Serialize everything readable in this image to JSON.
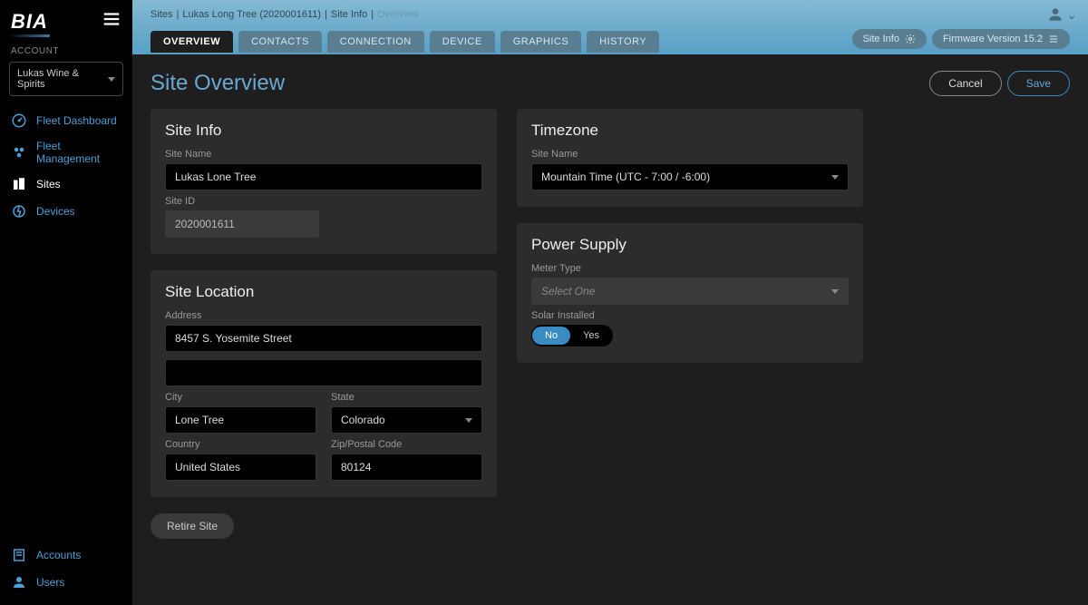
{
  "sidebar": {
    "logo": "BIA",
    "account_label": "ACCOUNT",
    "account_selected": "Lukas Wine & Spirits",
    "nav": [
      {
        "label": "Fleet Dashboard"
      },
      {
        "label": "Fleet Management"
      },
      {
        "label": "Sites"
      },
      {
        "label": "Devices"
      }
    ],
    "nav_bottom": [
      {
        "label": "Accounts"
      },
      {
        "label": "Users"
      }
    ]
  },
  "breadcrumbs": {
    "items": [
      "Sites",
      "Lukas Long Tree (2020001611)",
      "Site Info"
    ],
    "current": "Overview"
  },
  "tabs": {
    "items": [
      "OVERVIEW",
      "CONTACTS",
      "CONNECTION",
      "DEVICE",
      "GRAPHICS",
      "HISTORY"
    ]
  },
  "top_pills": {
    "site_info": "Site Info",
    "firmware": "Firmware Version 15.2"
  },
  "page": {
    "title": "Site Overview",
    "cancel": "Cancel",
    "save": "Save",
    "retire": "Retire Site"
  },
  "site_info": {
    "card_title": "Site Info",
    "name_label": "Site Name",
    "name_value": "Lukas Lone Tree",
    "id_label": "Site ID",
    "id_value": "2020001611"
  },
  "site_location": {
    "card_title": "Site Location",
    "address_label": "Address",
    "address1": "8457 S. Yosemite Street",
    "address2": "",
    "city_label": "City",
    "city": "Lone Tree",
    "state_label": "State",
    "state": "Colorado",
    "country_label": "Country",
    "country": "United States",
    "zip_label": "Zip/Postal Code",
    "zip": "80124"
  },
  "timezone": {
    "card_title": "Timezone",
    "label": "Site Name",
    "value": "Mountain Time  (UTC - 7:00 / -6:00)"
  },
  "power": {
    "card_title": "Power Supply",
    "meter_label": "Meter Type",
    "meter_placeholder": "Select One",
    "solar_label": "Solar Installed",
    "solar_no": "No",
    "solar_yes": "Yes"
  }
}
